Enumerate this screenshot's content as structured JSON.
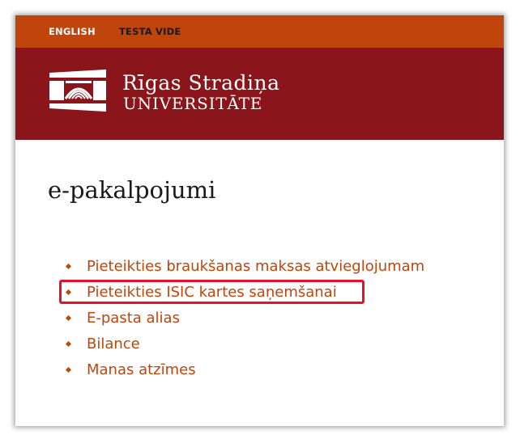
{
  "topbar": {
    "language_link": "ENGLISH",
    "environment_link": "TESTA VIDE",
    "background_color": "#c0450c"
  },
  "header": {
    "logo_icon": "rsu-logo-icon",
    "logo_line1": "Rīgas Stradiņa",
    "logo_line2": "UNIVERSITĀTE",
    "background_color": "#8a161b"
  },
  "main": {
    "title": "e-pakalpojumi",
    "services": [
      {
        "label": "Pieteikties braukšanas maksas atvieglojumam",
        "highlighted": false
      },
      {
        "label": "Pieteikties ISIC kartes saņemšanai",
        "highlighted": true
      },
      {
        "label": "E-pasta alias",
        "highlighted": false
      },
      {
        "label": "Bilance",
        "highlighted": false
      },
      {
        "label": "Manas atzīmes",
        "highlighted": false
      }
    ],
    "link_color": "#c0450c",
    "highlight_color": "#e8102a"
  }
}
